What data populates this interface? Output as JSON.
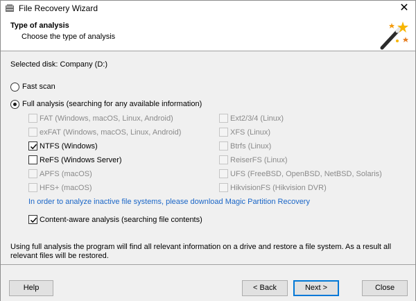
{
  "window": {
    "title": "File Recovery Wizard",
    "close_glyph": "✕"
  },
  "header": {
    "title": "Type of analysis",
    "subtitle": "Choose the type of analysis",
    "icon": "magic-wand-icon"
  },
  "selected_disk_text": "Selected disk: Company (D:)",
  "options": {
    "fast_scan": {
      "label": "Fast scan",
      "selected": false
    },
    "full_analysis": {
      "label": "Full analysis (searching for any available information)",
      "selected": true
    }
  },
  "filesystems_left": [
    {
      "label": "FAT (Windows, macOS, Linux, Android)",
      "checked": false,
      "enabled": false
    },
    {
      "label": "exFAT (Windows, macOS, Linux, Android)",
      "checked": false,
      "enabled": false
    },
    {
      "label": "NTFS (Windows)",
      "checked": true,
      "enabled": true
    },
    {
      "label": "ReFS (Windows Server)",
      "checked": false,
      "enabled": true
    },
    {
      "label": "APFS (macOS)",
      "checked": false,
      "enabled": false
    },
    {
      "label": "HFS+ (macOS)",
      "checked": false,
      "enabled": false
    }
  ],
  "filesystems_right": [
    {
      "label": "Ext2/3/4 (Linux)",
      "checked": false,
      "enabled": false
    },
    {
      "label": "XFS (Linux)",
      "checked": false,
      "enabled": false
    },
    {
      "label": "Btrfs (Linux)",
      "checked": false,
      "enabled": false
    },
    {
      "label": "ReiserFS (Linux)",
      "checked": false,
      "enabled": false
    },
    {
      "label": "UFS (FreeBSD, OpenBSD, NetBSD, Solaris)",
      "checked": false,
      "enabled": false
    },
    {
      "label": "HikvisionFS (Hikvision DVR)",
      "checked": false,
      "enabled": false
    }
  ],
  "link_text": "In order to analyze inactive file systems, please download Magic Partition Recovery",
  "content_aware": {
    "label": "Content-aware analysis (searching file contents)",
    "checked": true
  },
  "info_text": "Using full analysis the program will find all relevant information on a drive and restore a file system. As a result all relevant files will be restored.",
  "buttons": {
    "help": "Help",
    "back": "< Back",
    "next": "Next >",
    "close": "Close"
  }
}
